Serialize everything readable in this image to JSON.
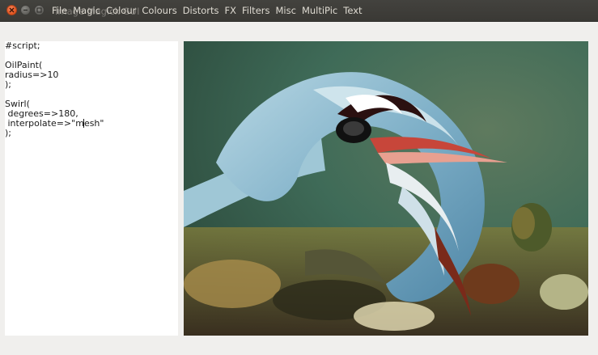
{
  "window": {
    "title": "Image Magick GUI",
    "controls": [
      "close-icon",
      "minimize-icon",
      "maximize-icon"
    ]
  },
  "menu": {
    "items": [
      "File",
      "Magic",
      "Colour",
      "Colours",
      "Distorts",
      "FX",
      "Filters",
      "Misc",
      "MultiPic",
      "Text"
    ]
  },
  "editor": {
    "lines": [
      "#script;",
      "",
      "OilPaint(",
      "radius=>10",
      ");",
      "",
      "Swirl(",
      " degrees=>180,",
      " interpolate=>\"mesh\"",
      ");"
    ],
    "caret": {
      "line": 8,
      "column": 16
    }
  },
  "preview": {
    "image": "oil-painted swirled hummingbird image"
  },
  "colors": {
    "titlebar": "#3c3b37",
    "menu_text": "#dfdbd2",
    "close_button": "#e95420",
    "window_bg": "#f0efed",
    "editor_bg": "#ffffff"
  }
}
